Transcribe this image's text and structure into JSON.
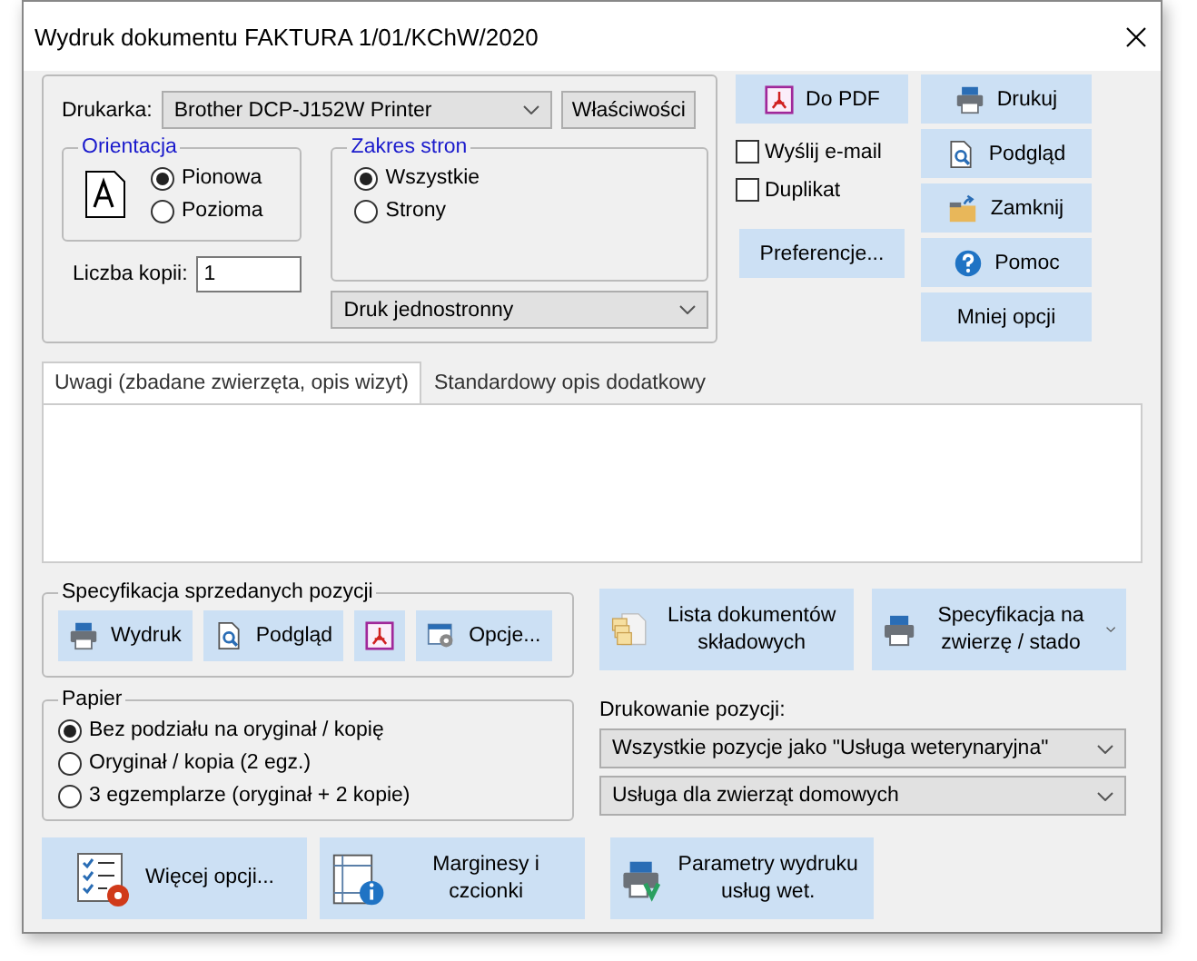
{
  "window": {
    "title": "Wydruk dokumentu FAKTURA 1/01/KChW/2020"
  },
  "printer": {
    "label": "Drukarka:",
    "value": "Brother DCP-J152W Printer",
    "properties_button": "Właściwości"
  },
  "orientation": {
    "title": "Orientacja",
    "options": [
      {
        "label": "Pionowa",
        "selected": true
      },
      {
        "label": "Pozioma",
        "selected": false
      }
    ]
  },
  "page_range": {
    "title": "Zakres stron",
    "options": [
      {
        "label": "Wszystkie",
        "selected": true
      },
      {
        "label": "Strony",
        "selected": false
      }
    ]
  },
  "copies": {
    "label": "Liczba kopii:",
    "value": "1"
  },
  "duplex": {
    "value": "Druk jednostronny"
  },
  "pdf_button": {
    "kind": "pdf",
    "label": "Do PDF"
  },
  "checkboxes": [
    {
      "label": "Wyślij e-mail",
      "checked": false
    },
    {
      "label": "Duplikat",
      "checked": false
    }
  ],
  "preferences_button": "Preferencje...",
  "actions": [
    {
      "kind": "print",
      "label": "Drukuj"
    },
    {
      "kind": "preview",
      "label": "Podgląd"
    },
    {
      "kind": "close",
      "label": "Zamknij"
    },
    {
      "kind": "help",
      "label": "Pomoc"
    },
    {
      "kind": "plain",
      "label": "Mniej opcji"
    }
  ],
  "tabs": [
    {
      "label": "Uwagi (zbadane zwierzęta, opis wizyt)",
      "selected": true
    },
    {
      "label": "Standardowy opis dodatkowy",
      "selected": false
    }
  ],
  "specification": {
    "title": "Specyfikacja sprzedanych pozycji",
    "buttons": [
      {
        "kind": "print",
        "label": "Wydruk"
      },
      {
        "kind": "preview",
        "label": "Podgląd"
      },
      {
        "kind": "pdf"
      },
      {
        "kind": "options",
        "label": "Opcje..."
      }
    ]
  },
  "big_buttons": [
    {
      "kind": "documents",
      "label": "Lista dokumentów składowych",
      "dropdown": false
    },
    {
      "kind": "printer",
      "label": "Specyfikacja na zwierzę / stado",
      "dropdown": true
    }
  ],
  "paper": {
    "title": "Papier",
    "options": [
      {
        "label": "Bez podziału na oryginał / kopię",
        "selected": true
      },
      {
        "label": "Oryginał / kopia (2 egz.)",
        "selected": false
      },
      {
        "label": "3 egzemplarze (oryginał + 2 kopie)",
        "selected": false
      }
    ]
  },
  "print_items": {
    "label": "Drukowanie pozycji:",
    "selects": [
      "Wszystkie pozycje jako \"Usługa weterynaryjna\"",
      "Usługa dla zwierząt domowych"
    ]
  },
  "bottom_buttons": [
    {
      "kind": "checklist",
      "label": "Więcej opcji..."
    },
    {
      "kind": "margins",
      "label": "Marginesy i czcionki"
    },
    {
      "kind": "vet-printer",
      "label": "Parametry wydruku usług wet."
    }
  ]
}
